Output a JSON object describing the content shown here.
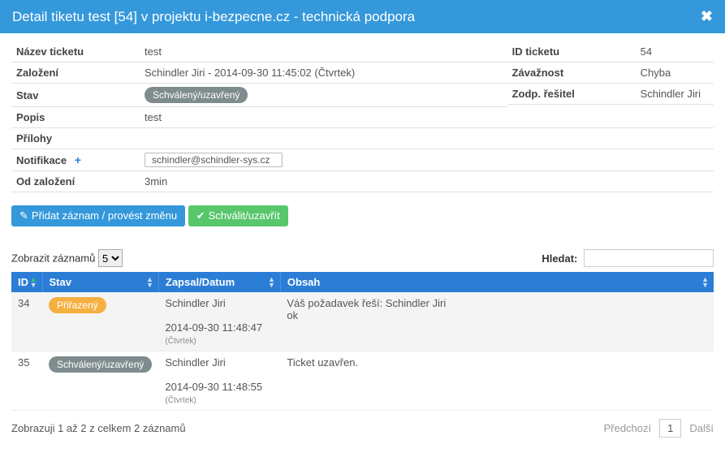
{
  "header": {
    "title": "Detail tiketu test [54] v projektu i-bezpecne.cz - technická podpora"
  },
  "details": {
    "name_label": "Název ticketu",
    "name_value": "test",
    "id_label": "ID ticketu",
    "id_value": "54",
    "creation_label": "Založení",
    "creation_value": "Schindler Jiri - 2014-09-30 11:45:02 (Čtvrtek)",
    "severity_label": "Závažnost",
    "severity_value": "Chyba",
    "state_label": "Stav",
    "state_value": "Schválený/uzavřený",
    "assignee_label": "Zodp. řešitel",
    "assignee_value": "Schindler Jiri",
    "desc_label": "Popis",
    "desc_value": "test",
    "attachments_label": "Přílohy",
    "notify_label": "Notifikace",
    "notify_email": "schindler@schindler-sys.cz",
    "since_label": "Od založení",
    "since_value": "3min"
  },
  "buttons": {
    "add_record": "Přidat záznam / provést změnu",
    "approve": "Schválit/uzavřít"
  },
  "table_controls": {
    "show_label_prefix": "Zobrazit záznamů",
    "page_size": "5",
    "search_label": "Hledat:",
    "search_value": ""
  },
  "columns": {
    "id": "ID",
    "stav": "Stav",
    "zapsal": "Zapsal/Datum",
    "obsah": "Obsah"
  },
  "rows": [
    {
      "id": "34",
      "stav_badge": "Přiřazený",
      "stav_class": "badge-orange",
      "author": "Schindler Jiri",
      "datetime": "2014-09-30 11:48:47",
      "day": "(Čtvrtek)",
      "content_line1": "Váš požadavek řeší: Schindler Jiri",
      "content_line2": "ok"
    },
    {
      "id": "35",
      "stav_badge": "Schválený/uzavřený",
      "stav_class": "badge-gray",
      "author": "Schindler Jiri",
      "datetime": "2014-09-30 11:48:55",
      "day": "(Čtvrtek)",
      "content_line1": "Ticket uzavřen.",
      "content_line2": ""
    }
  ],
  "footer": {
    "info": "Zobrazuji 1 až 2 z celkem 2 záznamů",
    "prev": "Předchozí",
    "page": "1",
    "next": "Další"
  }
}
